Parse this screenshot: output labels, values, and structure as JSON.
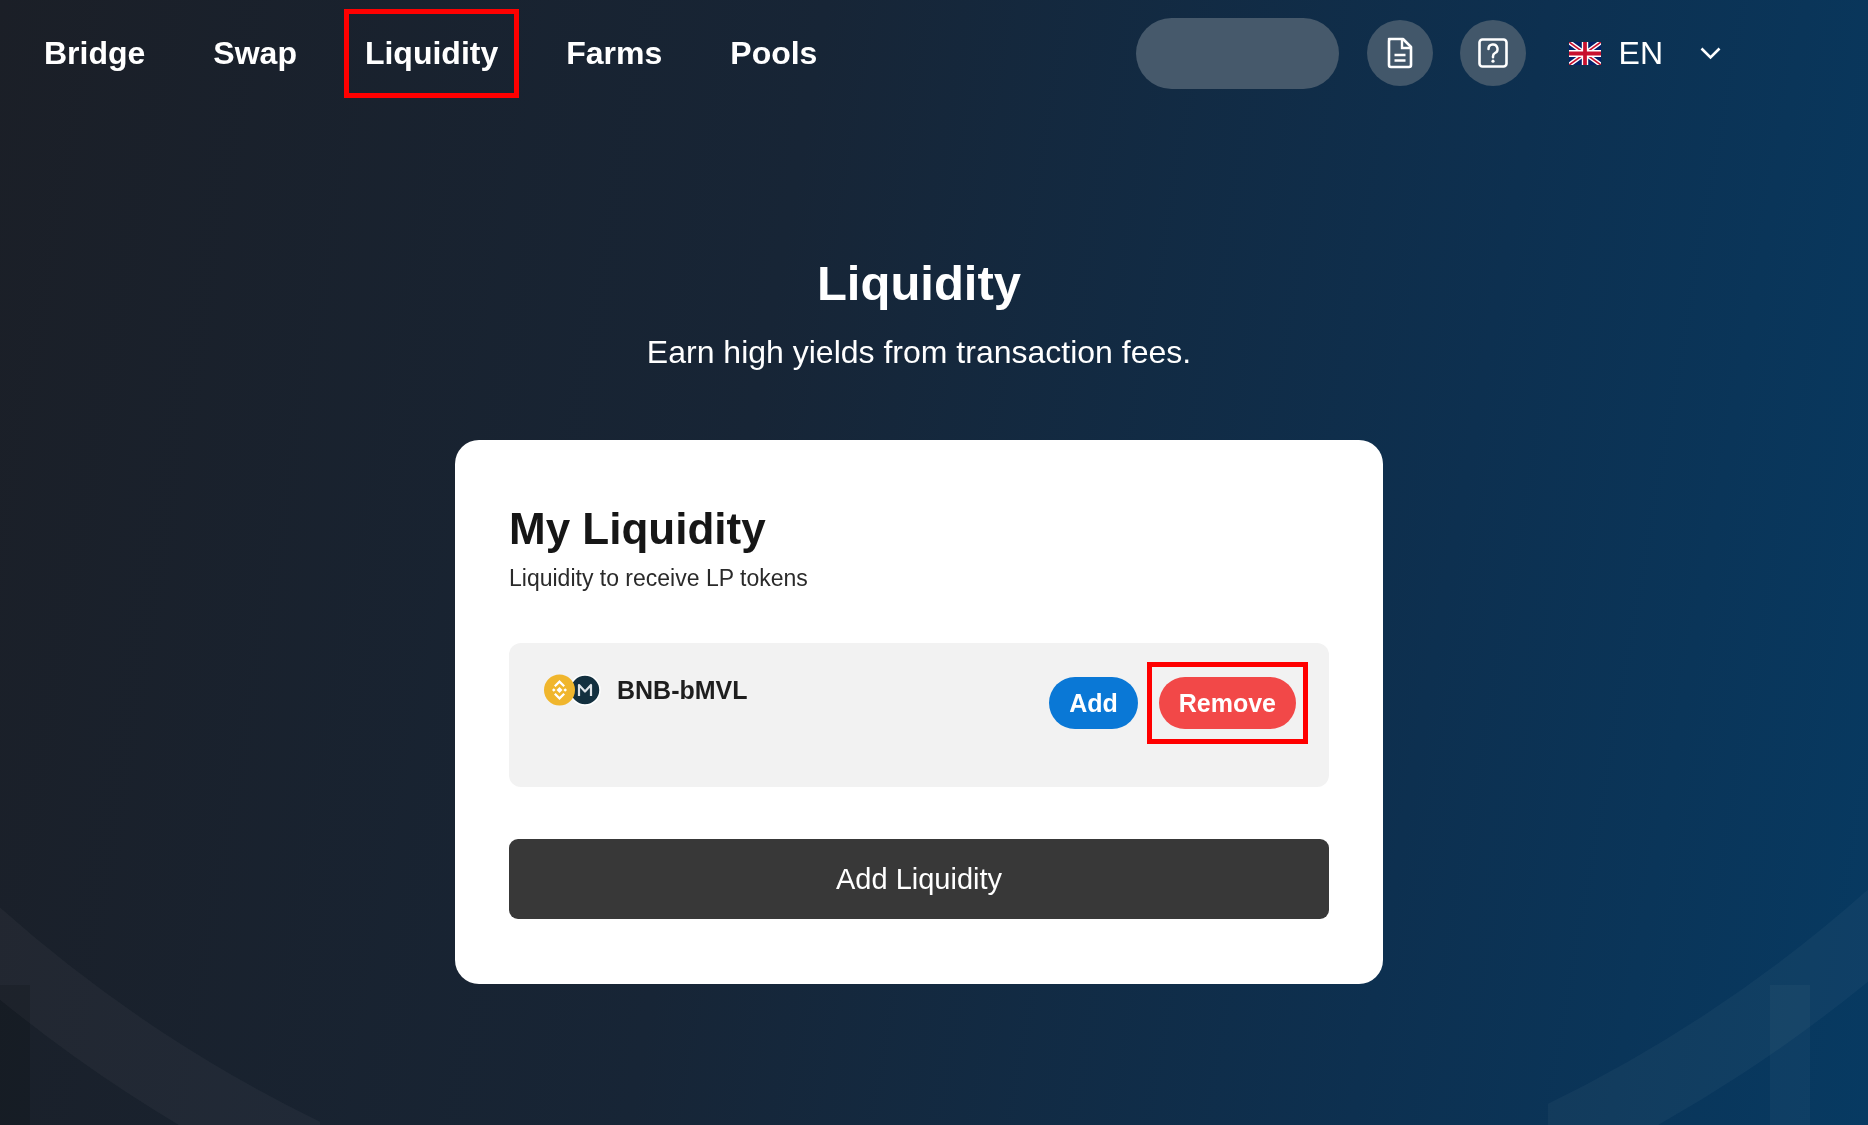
{
  "nav": {
    "items": [
      {
        "label": "Bridge",
        "highlighted": false
      },
      {
        "label": "Swap",
        "highlighted": false
      },
      {
        "label": "Liquidity",
        "highlighted": true
      },
      {
        "label": "Farms",
        "highlighted": false
      },
      {
        "label": "Pools",
        "highlighted": false
      }
    ],
    "language": {
      "code": "EN"
    }
  },
  "header": {
    "title": "Liquidity",
    "subtitle": "Earn high yields from transaction fees."
  },
  "card": {
    "title": "My Liquidity",
    "subtitle": "Liquidity to receive LP tokens",
    "positions": [
      {
        "pair": "BNB-bMVL",
        "buttons": [
          {
            "label": "Add",
            "kind": "add",
            "highlighted": false
          },
          {
            "label": "Remove",
            "kind": "remove",
            "highlighted": true
          }
        ]
      }
    ],
    "action": {
      "label": "Add Liquidity"
    }
  }
}
